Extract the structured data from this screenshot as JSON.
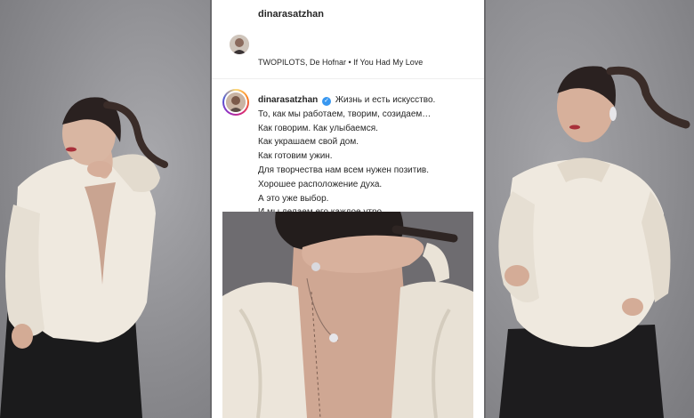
{
  "header": {
    "username": "dinarasatzhan",
    "music": "TWOPILOTS, De Hofnar • If You Had My Love"
  },
  "post": {
    "username": "dinarasatzhan",
    "verified_icon": "verified-badge-icon",
    "caption_lines": [
      "Жизнь и есть искусство.",
      "То, как мы работаем, творим, созидаем…",
      "Как говорим. Как улыбаемся.",
      "Как украшаем свой дом.",
      "Как готовим ужин.",
      "Для творчества нам всем нужен позитив.",
      "Хорошее расположение духа.",
      "А это уже выбор.",
      "И мы делаем его каждое утро…"
    ]
  },
  "colors": {
    "text": "#262626",
    "verified": "#3897f0",
    "backdrop": "#8f8f92",
    "blouse": "#efe9df"
  }
}
